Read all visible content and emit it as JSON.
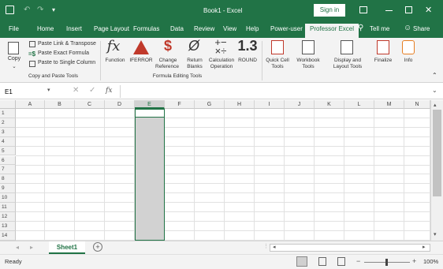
{
  "title": "Book1  -  Excel",
  "sign_in": "Sign in",
  "tabs": [
    "File",
    "Home",
    "Insert",
    "Page Layout",
    "Formulas",
    "Data",
    "Review",
    "View",
    "Help",
    "Power-user",
    "Professor Excel",
    "Tell me",
    "Share"
  ],
  "active_tab": "Professor Excel",
  "ribbon": {
    "copy": "Copy",
    "paste_link": "Paste Link & Transpose",
    "paste_exact": "Paste Exact Formula",
    "paste_single": "Paste to Single Column",
    "group1": "Copy and Paste Tools",
    "function": "Function",
    "iferror": "IFERROR",
    "change_ref_1": "Change",
    "change_ref_2": "Reference",
    "return_blanks_1": "Return",
    "return_blanks_2": "Blanks",
    "calc_op_1": "Calculation",
    "calc_op_2": "Operation",
    "round": "ROUND",
    "group2": "Formula Editing Tools",
    "quick_cell_1": "Quick Cell",
    "quick_cell_2": "Tools",
    "workbook_1": "Workbook",
    "workbook_2": "Tools",
    "display_1": "Display and",
    "display_2": "Layout Tools",
    "finalize": "Finalize",
    "info": "Info"
  },
  "name_box": "E1",
  "fx": "fx",
  "columns": [
    "A",
    "B",
    "C",
    "D",
    "E",
    "F",
    "G",
    "H",
    "I",
    "J",
    "K",
    "L",
    "M",
    "N"
  ],
  "rows": [
    "1",
    "2",
    "3",
    "4",
    "5",
    "6",
    "7",
    "8",
    "9",
    "10",
    "11",
    "12",
    "13",
    "14"
  ],
  "sheet_tab": "Sheet1",
  "status": "Ready",
  "zoom": "100%"
}
